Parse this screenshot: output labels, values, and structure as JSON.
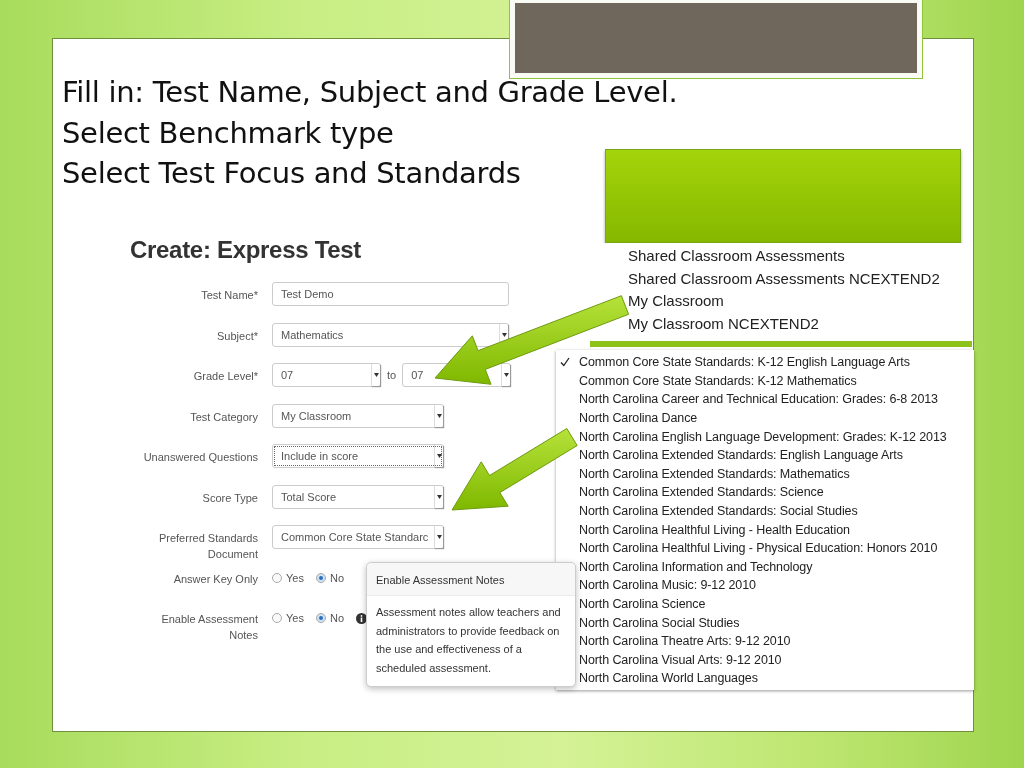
{
  "slide": {
    "lines": [
      "Fill in: Test Name, Subject and Grade Level.",
      "Select Benchmark type",
      "Select Test Focus and Standards"
    ]
  },
  "form": {
    "title": "Create: Express Test",
    "fields": [
      {
        "kind": "text",
        "label": "Test Name*",
        "value": "Test Demo",
        "wide": true
      },
      {
        "kind": "select",
        "label": "Subject*",
        "value": "Mathematics",
        "wide": true
      },
      {
        "kind": "range",
        "label": "Grade Level*",
        "from": "07",
        "separator": "to",
        "to": "07"
      },
      {
        "kind": "select",
        "label": "Test Category",
        "value": "My Classroom",
        "wide": false
      },
      {
        "kind": "select",
        "label": "Unanswered Questions",
        "value": "Include in score",
        "wide": false,
        "focused": true
      },
      {
        "kind": "select",
        "label": "Score Type",
        "value": "Total Score",
        "wide": false
      },
      {
        "kind": "select",
        "label": "Preferred Standards Document",
        "value": "Common Core State Standarc",
        "wide": false
      },
      {
        "kind": "radio",
        "label": "Answer Key Only",
        "info": false,
        "options": [
          {
            "label": "Yes",
            "selected": false
          },
          {
            "label": "No",
            "selected": true
          }
        ]
      },
      {
        "kind": "radio",
        "label": "Enable Assessment Notes",
        "info": true,
        "options": [
          {
            "label": "Yes",
            "selected": false
          },
          {
            "label": "No",
            "selected": true
          }
        ]
      }
    ]
  },
  "tooltip": {
    "title": "Enable Assessment Notes",
    "body": "Assessment notes allow teachers and administrators to provide feedback on the use and effectiveness of a scheduled assessment."
  },
  "category_menu": {
    "items": [
      "Shared Classroom Assessments",
      "Shared Classroom Assessments NCEXTEND2",
      "My Classroom",
      "My Classroom NCEXTEND2"
    ]
  },
  "standards_menu": {
    "items": [
      {
        "label": "Common Core State Standards: K-12 English Language Arts",
        "checked": true
      },
      {
        "label": "Common Core State Standards: K-12 Mathematics",
        "checked": false
      },
      {
        "label": "North Carolina Career and Technical Education: Grades: 6-8 2013",
        "checked": false
      },
      {
        "label": "North Carolina Dance",
        "checked": false
      },
      {
        "label": "North Carolina English Language Development: Grades: K-12 2013",
        "checked": false
      },
      {
        "label": "North Carolina Extended Standards: English Language Arts",
        "checked": false
      },
      {
        "label": "North Carolina Extended Standards: Mathematics",
        "checked": false
      },
      {
        "label": "North Carolina Extended Standards: Science",
        "checked": false
      },
      {
        "label": "North Carolina Extended Standards: Social Studies",
        "checked": false
      },
      {
        "label": "North Carolina Healthful Living - Health Education",
        "checked": false
      },
      {
        "label": "North Carolina Healthful Living - Physical Education: Honors 2010",
        "checked": false
      },
      {
        "label": "North Carolina Information and Technology",
        "checked": false
      },
      {
        "label": "North Carolina Music: 9-12 2010",
        "checked": false
      },
      {
        "label": "North Carolina Science",
        "checked": false
      },
      {
        "label": "North Carolina Social Studies",
        "checked": false
      },
      {
        "label": "North Carolina Theatre Arts: 9-12 2010",
        "checked": false
      },
      {
        "label": "North Carolina Visual Arts: 9-12 2010",
        "checked": false
      },
      {
        "label": "North Carolina World Languages",
        "checked": false
      }
    ]
  }
}
